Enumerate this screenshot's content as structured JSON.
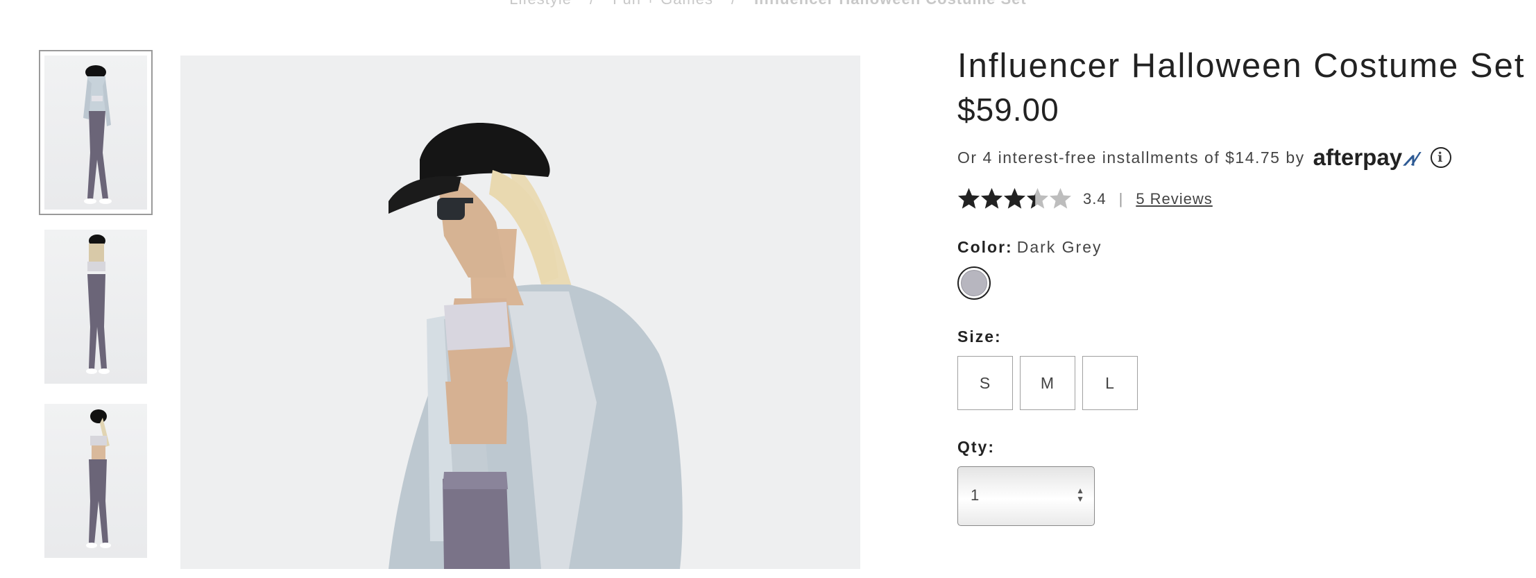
{
  "breadcrumb": {
    "items": [
      "Lifestyle",
      "Fun + Games",
      "Influencer Halloween Costume Set"
    ],
    "separator": "/"
  },
  "product": {
    "title": "Influencer Halloween Costume Set",
    "price": "$59.00",
    "installments_text": "Or 4 interest-free installments of $14.75 by",
    "afterpay_logo": "afterpay",
    "info_icon": "info-circle-icon",
    "rating_value": "3.4",
    "rating_fraction": 0.68,
    "rating_separator": "|",
    "reviews_link": "5 Reviews",
    "color_label": "Color:",
    "color_value": "Dark Grey",
    "swatch_color": "#b7b6bf",
    "size_label": "Size:",
    "sizes": [
      "S",
      "M",
      "L"
    ],
    "qty_label": "Qty:",
    "qty_value": "1",
    "qty_arrows": "▲\n▼"
  },
  "gallery": {
    "thumbnail_count": 3,
    "active_index": 0
  }
}
